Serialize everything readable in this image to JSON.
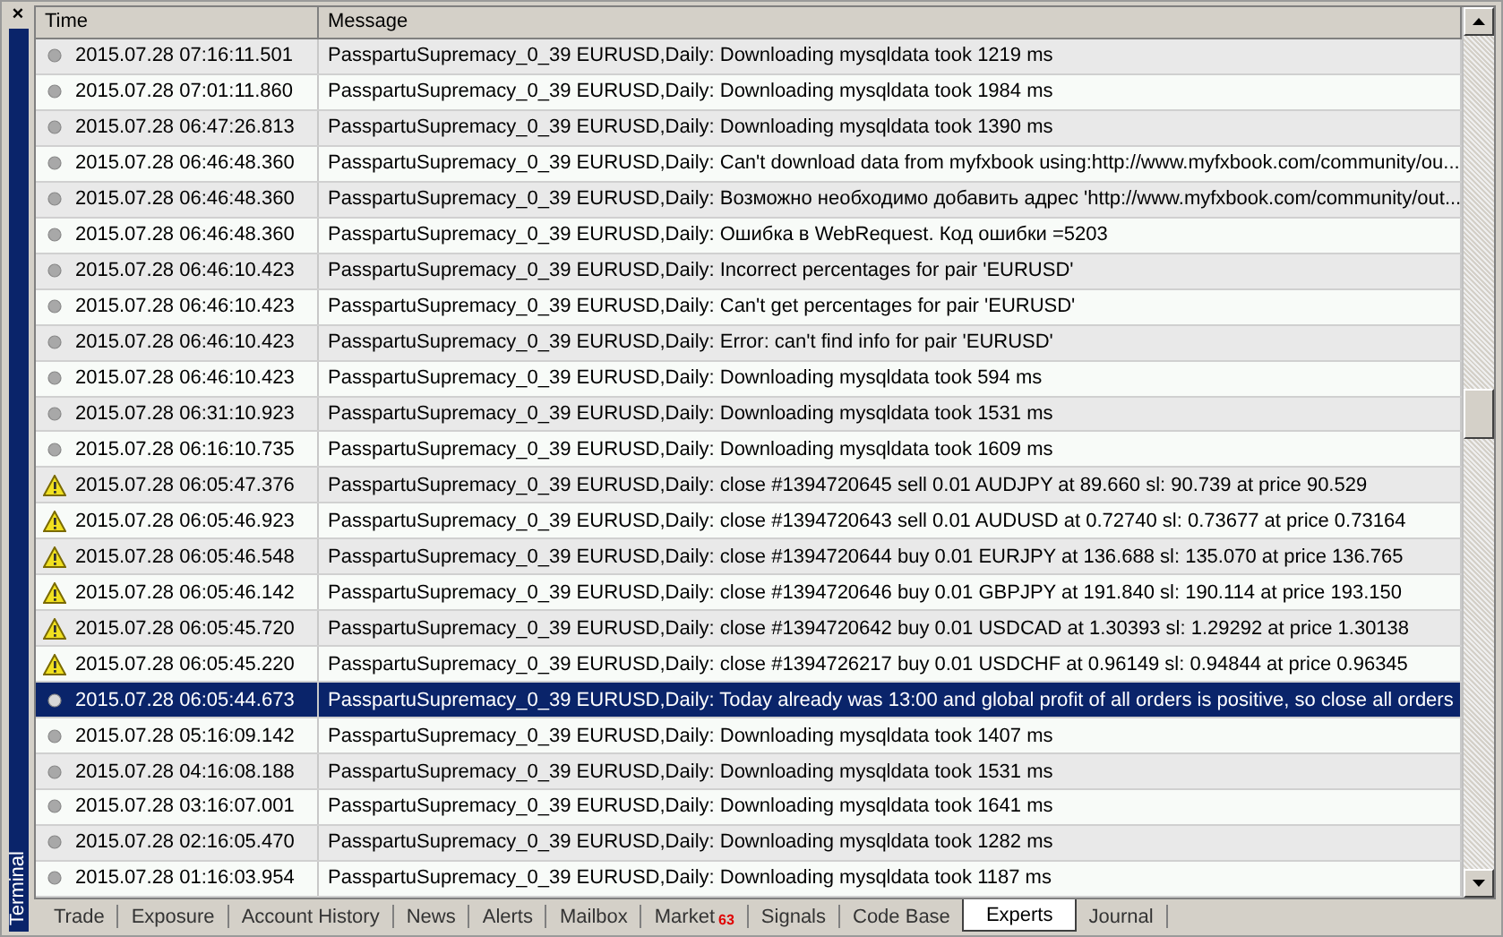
{
  "panel": {
    "title": "Terminal",
    "close": "×"
  },
  "table": {
    "columns": [
      "Time",
      "Message"
    ],
    "rows": [
      {
        "kind": "info",
        "selected": false,
        "time": "2015.07.28 07:16:11.501",
        "message": "PasspartuSupremacy_0_39 EURUSD,Daily: Downloading mysqldata took 1219 ms"
      },
      {
        "kind": "info",
        "selected": false,
        "time": "2015.07.28 07:01:11.860",
        "message": "PasspartuSupremacy_0_39 EURUSD,Daily: Downloading mysqldata took 1984 ms"
      },
      {
        "kind": "info",
        "selected": false,
        "time": "2015.07.28 06:47:26.813",
        "message": "PasspartuSupremacy_0_39 EURUSD,Daily: Downloading mysqldata took 1390 ms"
      },
      {
        "kind": "info",
        "selected": false,
        "time": "2015.07.28 06:46:48.360",
        "message": "PasspartuSupremacy_0_39 EURUSD,Daily: Can't download data from myfxbook using:http://www.myfxbook.com/community/ou..."
      },
      {
        "kind": "info",
        "selected": false,
        "time": "2015.07.28 06:46:48.360",
        "message": "PasspartuSupremacy_0_39 EURUSD,Daily: Возможно необходимо добавить адрес 'http://www.myfxbook.com/community/out..."
      },
      {
        "kind": "info",
        "selected": false,
        "time": "2015.07.28 06:46:48.360",
        "message": "PasspartuSupremacy_0_39 EURUSD,Daily: Ошибка в WebRequest. Код ошибки  =5203"
      },
      {
        "kind": "info",
        "selected": false,
        "time": "2015.07.28 06:46:10.423",
        "message": "PasspartuSupremacy_0_39 EURUSD,Daily: Incorrect percentages for pair 'EURUSD'"
      },
      {
        "kind": "info",
        "selected": false,
        "time": "2015.07.28 06:46:10.423",
        "message": "PasspartuSupremacy_0_39 EURUSD,Daily: Can't get percentages for pair 'EURUSD'"
      },
      {
        "kind": "info",
        "selected": false,
        "time": "2015.07.28 06:46:10.423",
        "message": "PasspartuSupremacy_0_39 EURUSD,Daily: Error: can't find info for pair 'EURUSD'"
      },
      {
        "kind": "info",
        "selected": false,
        "time": "2015.07.28 06:46:10.423",
        "message": "PasspartuSupremacy_0_39 EURUSD,Daily: Downloading mysqldata took 594 ms"
      },
      {
        "kind": "info",
        "selected": false,
        "time": "2015.07.28 06:31:10.923",
        "message": "PasspartuSupremacy_0_39 EURUSD,Daily: Downloading mysqldata took 1531 ms"
      },
      {
        "kind": "info",
        "selected": false,
        "time": "2015.07.28 06:16:10.735",
        "message": "PasspartuSupremacy_0_39 EURUSD,Daily: Downloading mysqldata took 1609 ms"
      },
      {
        "kind": "warning",
        "selected": false,
        "time": "2015.07.28 06:05:47.376",
        "message": "PasspartuSupremacy_0_39 EURUSD,Daily: close #1394720645 sell 0.01 AUDJPY at 89.660 sl: 90.739 at price 90.529"
      },
      {
        "kind": "warning",
        "selected": false,
        "time": "2015.07.28 06:05:46.923",
        "message": "PasspartuSupremacy_0_39 EURUSD,Daily: close #1394720643 sell 0.01 AUDUSD at 0.72740 sl: 0.73677 at price 0.73164"
      },
      {
        "kind": "warning",
        "selected": false,
        "time": "2015.07.28 06:05:46.548",
        "message": "PasspartuSupremacy_0_39 EURUSD,Daily: close #1394720644 buy 0.01 EURJPY at 136.688 sl: 135.070 at price 136.765"
      },
      {
        "kind": "warning",
        "selected": false,
        "time": "2015.07.28 06:05:46.142",
        "message": "PasspartuSupremacy_0_39 EURUSD,Daily: close #1394720646 buy 0.01 GBPJPY at 191.840 sl: 190.114 at price 193.150"
      },
      {
        "kind": "warning",
        "selected": false,
        "time": "2015.07.28 06:05:45.720",
        "message": "PasspartuSupremacy_0_39 EURUSD,Daily: close #1394720642 buy 0.01 USDCAD at 1.30393 sl: 1.29292 at price 1.30138"
      },
      {
        "kind": "warning",
        "selected": false,
        "time": "2015.07.28 06:05:45.220",
        "message": "PasspartuSupremacy_0_39 EURUSD,Daily: close #1394726217 buy 0.01 USDCHF at 0.96149 sl: 0.94844 at price 0.96345"
      },
      {
        "kind": "info",
        "selected": true,
        "time": "2015.07.28 06:05:44.673",
        "message": "PasspartuSupremacy_0_39 EURUSD,Daily: Today already was 13:00 and global profit of all orders is positive, so close all orders"
      },
      {
        "kind": "info",
        "selected": false,
        "time": "2015.07.28 05:16:09.142",
        "message": "PasspartuSupremacy_0_39 EURUSD,Daily: Downloading mysqldata took 1407 ms"
      },
      {
        "kind": "info",
        "selected": false,
        "time": "2015.07.28 04:16:08.188",
        "message": "PasspartuSupremacy_0_39 EURUSD,Daily: Downloading mysqldata took 1531 ms"
      },
      {
        "kind": "info",
        "selected": false,
        "time": "2015.07.28 03:16:07.001",
        "message": "PasspartuSupremacy_0_39 EURUSD,Daily: Downloading mysqldata took 1641 ms"
      },
      {
        "kind": "info",
        "selected": false,
        "time": "2015.07.28 02:16:05.470",
        "message": "PasspartuSupremacy_0_39 EURUSD,Daily: Downloading mysqldata took 1282 ms"
      },
      {
        "kind": "info",
        "selected": false,
        "time": "2015.07.28 01:16:03.954",
        "message": "PasspartuSupremacy_0_39 EURUSD,Daily: Downloading mysqldata took 1187 ms"
      }
    ]
  },
  "tabs": [
    {
      "label": "Trade",
      "selected": false
    },
    {
      "label": "Exposure",
      "selected": false
    },
    {
      "label": "Account History",
      "selected": false
    },
    {
      "label": "News",
      "selected": false
    },
    {
      "label": "Alerts",
      "selected": false
    },
    {
      "label": "Mailbox",
      "selected": false
    },
    {
      "label": "Market",
      "badge": "63",
      "selected": false
    },
    {
      "label": "Signals",
      "selected": false
    },
    {
      "label": "Code Base",
      "selected": false
    },
    {
      "label": "Experts",
      "selected": true
    },
    {
      "label": "Journal",
      "selected": false
    }
  ]
}
